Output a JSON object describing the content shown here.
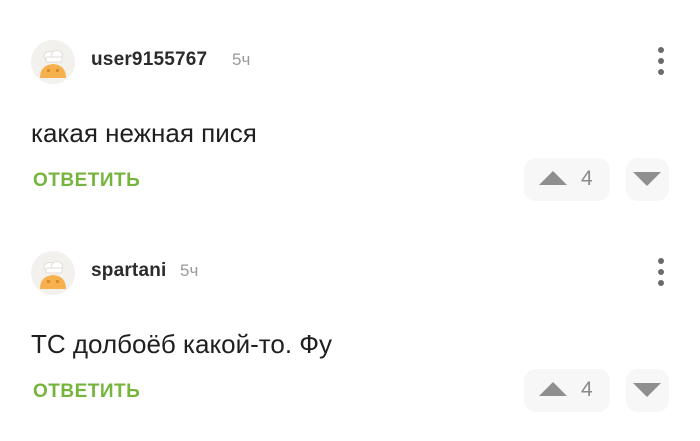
{
  "comments": [
    {
      "username": "user9155767",
      "time": "5ч",
      "text": "какая нежная пися",
      "reply_label": "ОТВЕТИТЬ",
      "rating": "4"
    },
    {
      "username": "spartani",
      "time": "5ч",
      "text": "ТС долбоёб какой-то. Фу",
      "reply_label": "ОТВЕТИТЬ",
      "rating": "4"
    }
  ],
  "icons": {
    "avatar": "cook-avatar-icon",
    "menu": "more-vertical-icon",
    "upvote": "arrow-up-icon",
    "downvote": "arrow-down-icon"
  },
  "colors": {
    "accent": "#76b53d",
    "username": "#2b2b2b",
    "muted": "#9a9a9a",
    "vote_bg": "#f7f7f7"
  }
}
